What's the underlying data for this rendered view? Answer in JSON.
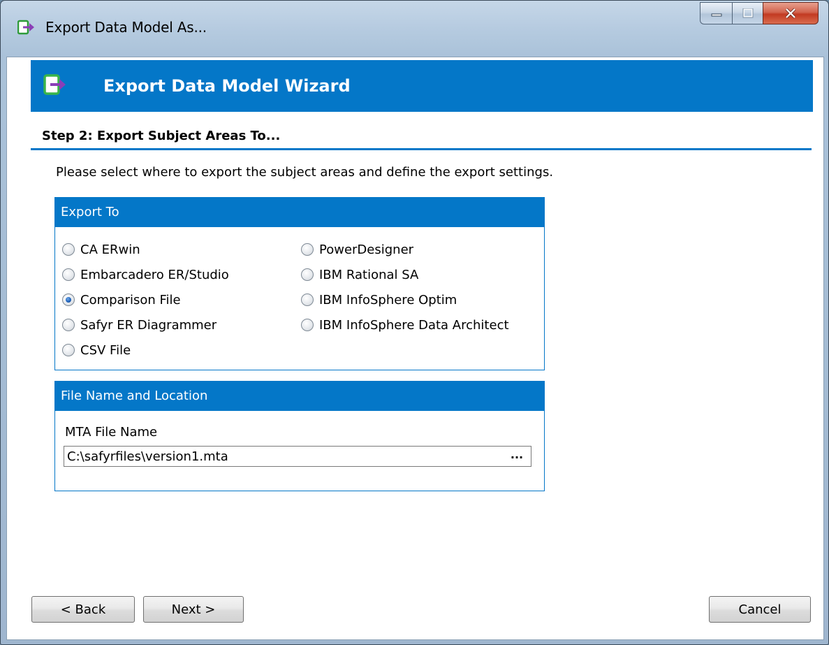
{
  "window": {
    "title": "Export Data Model As...",
    "icon": "export-arrow-icon",
    "controls": [
      "minimize-icon",
      "maximize-icon",
      "close-icon"
    ]
  },
  "banner": {
    "title": "Export Data Model Wizard",
    "icon": "export-arrow-icon",
    "color": "#0477c8"
  },
  "step": {
    "title": "Step 2: Export Subject Areas To...",
    "instructions": "Please select where to export the subject areas and define the export settings."
  },
  "export_to": {
    "header": "Export To",
    "selected": "Comparison File",
    "column1": [
      {
        "label": "CA ERwin",
        "checked": false
      },
      {
        "label": "Embarcadero ER/Studio",
        "checked": false
      },
      {
        "label": "Comparison File",
        "checked": true
      },
      {
        "label": "Safyr ER Diagrammer",
        "checked": false
      },
      {
        "label": "CSV File",
        "checked": false
      }
    ],
    "column2": [
      {
        "label": "PowerDesigner",
        "checked": false
      },
      {
        "label": "IBM Rational SA",
        "checked": false
      },
      {
        "label": "IBM InfoSphere Optim",
        "checked": false
      },
      {
        "label": "IBM InfoSphere Data Architect",
        "checked": false
      }
    ]
  },
  "file_location": {
    "header": "File Name and Location",
    "field_label": "MTA File Name",
    "field_value": "C:\\safyrfiles\\version1.mta",
    "browse_label": "..."
  },
  "buttons": {
    "back": "< Back",
    "next": "Next >",
    "cancel": "Cancel"
  }
}
